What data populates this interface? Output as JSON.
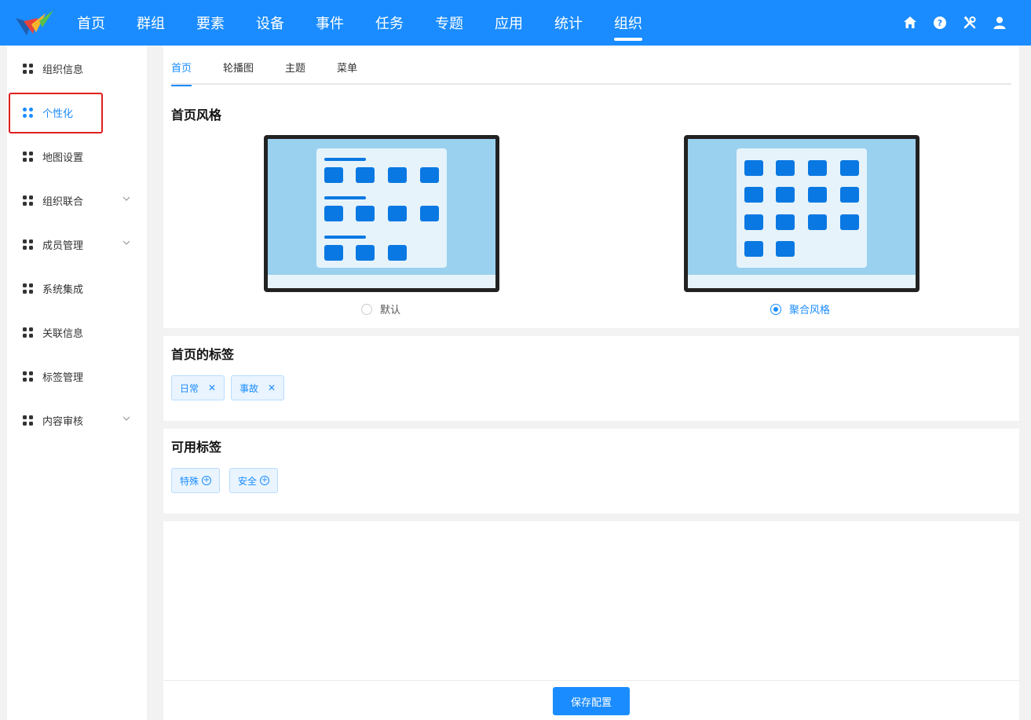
{
  "nav": {
    "items": [
      "首页",
      "群组",
      "要素",
      "设备",
      "事件",
      "任务",
      "专题",
      "应用",
      "统计",
      "组织"
    ],
    "active_index": 9
  },
  "top_icons": [
    "home-icon",
    "help-icon",
    "tools-icon",
    "user-icon"
  ],
  "sidebar": {
    "items": [
      {
        "label": "组织信息",
        "expandable": false
      },
      {
        "label": "个性化",
        "expandable": false,
        "active": true
      },
      {
        "label": "地图设置",
        "expandable": false
      },
      {
        "label": "组织联合",
        "expandable": true
      },
      {
        "label": "成员管理",
        "expandable": true
      },
      {
        "label": "系统集成",
        "expandable": false
      },
      {
        "label": "关联信息",
        "expandable": false
      },
      {
        "label": "标签管理",
        "expandable": false
      },
      {
        "label": "内容审核",
        "expandable": true
      }
    ]
  },
  "tabs": [
    "首页",
    "轮播图",
    "主题",
    "菜单"
  ],
  "active_tab": 0,
  "homepage_style": {
    "title": "首页风格",
    "options": [
      {
        "label": "默认",
        "checked": false
      },
      {
        "label": "聚合风格",
        "checked": true
      }
    ]
  },
  "homepage_tags": {
    "title": "首页的标签",
    "tags": [
      "日常",
      "事故"
    ]
  },
  "available_tags": {
    "title": "可用标签",
    "tags": [
      "特殊",
      "安全"
    ]
  },
  "footer": {
    "save_label": "保存配置"
  },
  "colors": {
    "primary": "#1a8cff",
    "highlight_box": "#e02020"
  }
}
